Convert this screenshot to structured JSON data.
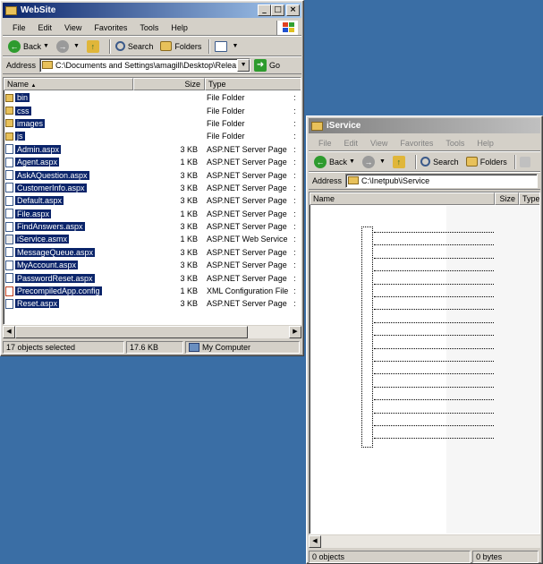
{
  "website": {
    "title": "WebSite",
    "menu": [
      "File",
      "Edit",
      "View",
      "Favorites",
      "Tools",
      "Help"
    ],
    "toolbar": {
      "back": "Back",
      "search": "Search",
      "folders": "Folders"
    },
    "address": {
      "label": "Address",
      "path": "C:\\Documents and Settings\\amagill\\Desktop\\Relea",
      "go": "Go"
    },
    "columns": {
      "name": "Name",
      "size": "Size",
      "type": "Type"
    },
    "files": [
      {
        "name": "bin",
        "size": "",
        "type": "File Folder",
        "icon": "folder"
      },
      {
        "name": "css",
        "size": "",
        "type": "File Folder",
        "icon": "folder"
      },
      {
        "name": "images",
        "size": "",
        "type": "File Folder",
        "icon": "folder"
      },
      {
        "name": "js",
        "size": "",
        "type": "File Folder",
        "icon": "folder"
      },
      {
        "name": "Admin.aspx",
        "size": "3 KB",
        "type": "ASP.NET Server Page",
        "icon": "page"
      },
      {
        "name": "Agent.aspx",
        "size": "1 KB",
        "type": "ASP.NET Server Page",
        "icon": "page"
      },
      {
        "name": "AskAQuestion.aspx",
        "size": "3 KB",
        "type": "ASP.NET Server Page",
        "icon": "page"
      },
      {
        "name": "CustomerInfo.aspx",
        "size": "3 KB",
        "type": "ASP.NET Server Page",
        "icon": "page"
      },
      {
        "name": "Default.aspx",
        "size": "3 KB",
        "type": "ASP.NET Server Page",
        "icon": "page"
      },
      {
        "name": "File.aspx",
        "size": "1 KB",
        "type": "ASP.NET Server Page",
        "icon": "page"
      },
      {
        "name": "FindAnswers.aspx",
        "size": "3 KB",
        "type": "ASP.NET Server Page",
        "icon": "page"
      },
      {
        "name": "iService.asmx",
        "size": "1 KB",
        "type": "ASP.NET Web Service",
        "icon": "webservice"
      },
      {
        "name": "MessageQueue.aspx",
        "size": "3 KB",
        "type": "ASP.NET Server Page",
        "icon": "page"
      },
      {
        "name": "MyAccount.aspx",
        "size": "3 KB",
        "type": "ASP.NET Server Page",
        "icon": "page"
      },
      {
        "name": "PasswordReset.aspx",
        "size": "3 KB",
        "type": "ASP.NET Server Page",
        "icon": "page"
      },
      {
        "name": "PrecompiledApp.config",
        "size": "1 KB",
        "type": "XML Configuration File",
        "icon": "xml"
      },
      {
        "name": "Reset.aspx",
        "size": "3 KB",
        "type": "ASP.NET Server Page",
        "icon": "page"
      }
    ],
    "status": {
      "selected": "17 objects selected",
      "size": "17.6 KB",
      "zone": "My Computer"
    }
  },
  "iservice": {
    "title": "iService",
    "menu": [
      "File",
      "Edit",
      "View",
      "Favorites",
      "Tools",
      "Help"
    ],
    "toolbar": {
      "back": "Back",
      "search": "Search",
      "folders": "Folders"
    },
    "address": {
      "label": "Address",
      "path": "C:\\Inetpub\\iService"
    },
    "columns": {
      "name": "Name",
      "size": "Size",
      "type": "Type"
    },
    "status": {
      "objects": "0 objects",
      "size": "0 bytes"
    }
  }
}
